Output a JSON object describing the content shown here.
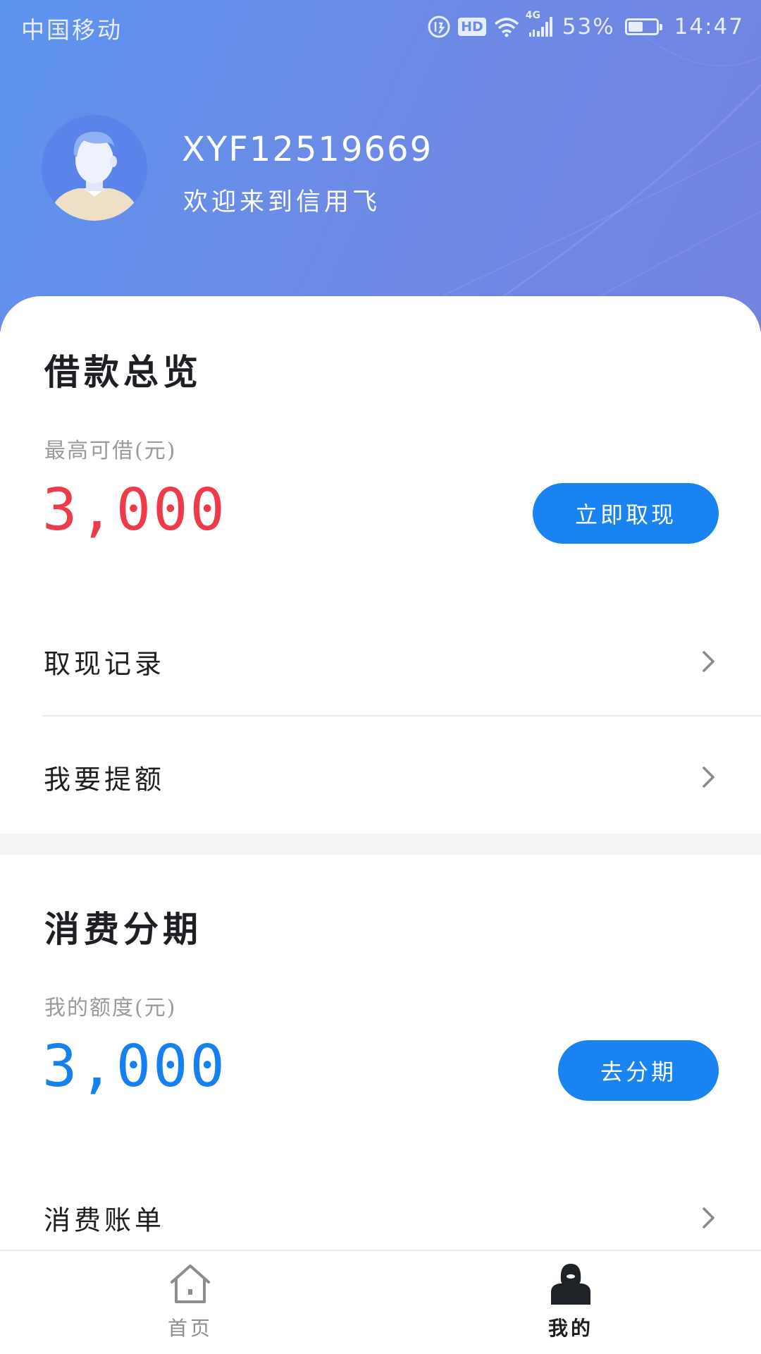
{
  "status_bar": {
    "carrier": "中国移动",
    "hd": "HD",
    "network": "4G",
    "battery_percent": "53%",
    "battery_level": 0.53,
    "time": "14:47"
  },
  "profile": {
    "username": "XYF12519669",
    "welcome": "欢迎来到信用飞"
  },
  "loan_overview": {
    "title": "借款总览",
    "limit_label": "最高可借(元)",
    "limit_amount": "3,000",
    "withdraw_button": "立即取现",
    "rows": [
      {
        "label": "取现记录"
      },
      {
        "label": "我要提额"
      }
    ]
  },
  "installment": {
    "title": "消费分期",
    "quota_label": "我的额度(元)",
    "quota_amount": "3,000",
    "installment_button": "去分期",
    "rows": [
      {
        "label": "消费账单"
      }
    ]
  },
  "tabbar": {
    "tabs": [
      {
        "label": "首页",
        "icon": "home-icon",
        "active": false
      },
      {
        "label": "我的",
        "icon": "user-icon",
        "active": true
      }
    ]
  },
  "colors": {
    "header_gradient_start": "#5c93ef",
    "header_gradient_end": "#7482e0",
    "primary_button": "#1a83f2",
    "amount_red": "#ef3a4a",
    "amount_blue": "#1580f0"
  }
}
